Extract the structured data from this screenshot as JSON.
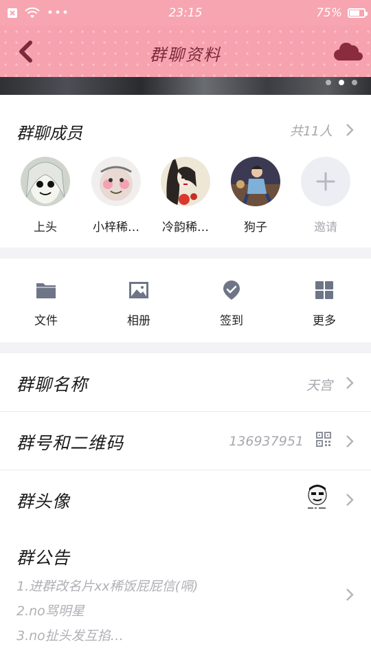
{
  "status_bar": {
    "time": "23:15",
    "battery": "75%",
    "battery_level": 0.75
  },
  "nav": {
    "title": "群聊资料"
  },
  "banner": {
    "page_count": 3,
    "active_page": 2
  },
  "members_section": {
    "label": "群聊成员",
    "count": "共11人",
    "members": [
      {
        "name": "上头"
      },
      {
        "name": "小梓稀…"
      },
      {
        "name": "冷韵稀…"
      },
      {
        "name": "狗子"
      },
      {
        "name": "邀请"
      }
    ]
  },
  "tools": [
    {
      "label": "文件",
      "icon": "folder-icon"
    },
    {
      "label": "相册",
      "icon": "photo-icon"
    },
    {
      "label": "签到",
      "icon": "check-badge-icon"
    },
    {
      "label": "更多",
      "icon": "grid-icon"
    }
  ],
  "rows": {
    "name": {
      "label": "群聊名称",
      "value": "天宫"
    },
    "number": {
      "label": "群号和二维码",
      "value": "136937951"
    },
    "avatar": {
      "label": "群头像"
    }
  },
  "notice": {
    "label": "群公告",
    "lines": [
      "1.进群改名片xx稀饭屁屁信(嗝)",
      "2.no骂明星",
      "3.no扯头发互掐…"
    ]
  },
  "colors": {
    "accent_pink": "#f7a3af",
    "title_dark": "#7a2a3a",
    "muted_text": "#a8a8ae"
  }
}
